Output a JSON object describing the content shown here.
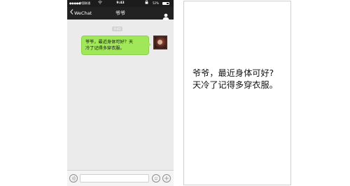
{
  "status_bar": {
    "carrier": "中国联通",
    "time": "9:43",
    "battery_text": "52%",
    "battery_level": 0.52
  },
  "nav": {
    "back_label": "WeChat",
    "title": "爷爷"
  },
  "chat": {
    "timestamp": "9:43",
    "message": {
      "line1": "爷爷，最近身体可好？天",
      "line2": "冷了记得多穿衣服。"
    }
  },
  "panel": {
    "line1": "爷爷，最近身体可好?",
    "line2": "天冷了记得多穿衣服。"
  },
  "colors": {
    "bubble": "#a0e75a",
    "nav_bar": "#222222",
    "chat_bg": "#ebebeb"
  },
  "icons": [
    "back-chevron-icon",
    "contact-person-icon",
    "wifi-icon",
    "lock-icon",
    "battery-icon",
    "voice-icon",
    "emoji-icon",
    "plus-icon"
  ]
}
